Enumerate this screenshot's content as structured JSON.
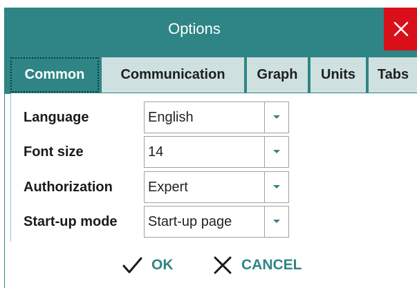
{
  "window": {
    "title": "Options"
  },
  "tabs": [
    {
      "label": "Common",
      "active": true
    },
    {
      "label": "Communication",
      "active": false
    },
    {
      "label": "Graph",
      "active": false
    },
    {
      "label": "Units",
      "active": false
    },
    {
      "label": "Tabs",
      "active": false
    }
  ],
  "fields": [
    {
      "label": "Language",
      "value": "English"
    },
    {
      "label": "Font size",
      "value": "14"
    },
    {
      "label": "Authorization",
      "value": "Expert"
    },
    {
      "label": "Start-up mode",
      "value": "Start-up page"
    }
  ],
  "footer": {
    "ok_label": "OK",
    "cancel_label": "CANCEL"
  },
  "colors": {
    "accent": "#2f8585",
    "close": "#d90f1a",
    "tab_inactive": "#cfe0e0"
  },
  "icons": {
    "close": "close-icon",
    "dropdown": "chevron-down-icon",
    "ok": "check-icon",
    "cancel": "x-icon"
  }
}
